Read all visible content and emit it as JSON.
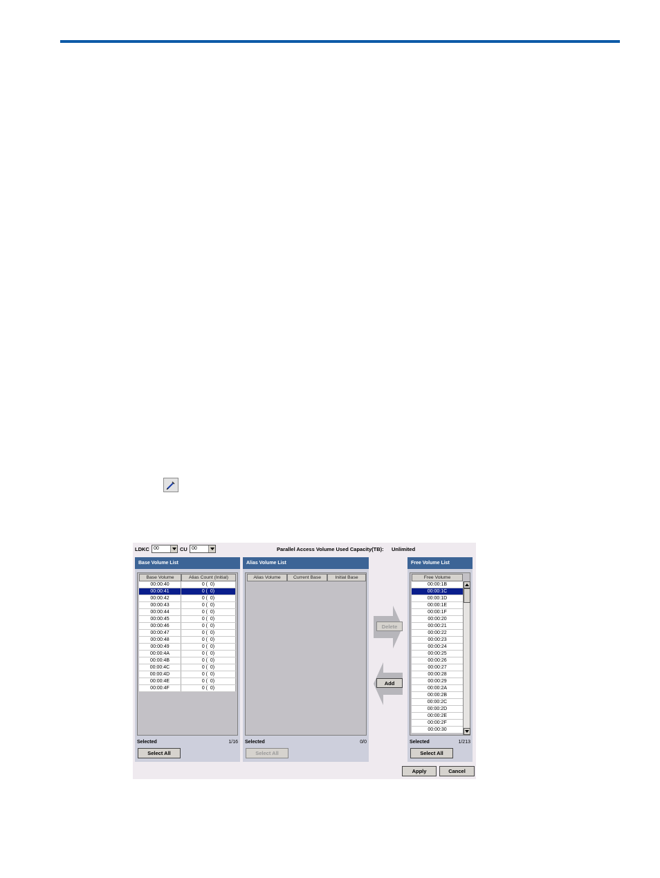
{
  "dialog": {
    "ldkc_label": "LDKC",
    "ldkc_value": "00",
    "cu_label": "CU",
    "cu_value": "00",
    "capacity_label": "Parallel Access Volume Used Capacity(TB):",
    "capacity_value": "Unlimited"
  },
  "base_panel": {
    "title": "Base Volume List",
    "columns": [
      "Base Volume",
      "Alias Count (Initial)"
    ],
    "rows": [
      [
        "00:00:40",
        "0 (  0)"
      ],
      [
        "00:00:41",
        "0 (  0)"
      ],
      [
        "00:00:42",
        "0 (  0)"
      ],
      [
        "00:00:43",
        "0 (  0)"
      ],
      [
        "00:00:44",
        "0 (  0)"
      ],
      [
        "00:00:45",
        "0 (  0)"
      ],
      [
        "00:00:46",
        "0 (  0)"
      ],
      [
        "00:00:47",
        "0 (  0)"
      ],
      [
        "00:00:48",
        "0 (  0)"
      ],
      [
        "00:00:49",
        "0 (  0)"
      ],
      [
        "00:00:4A",
        "0 (  0)"
      ],
      [
        "00:00:4B",
        "0 (  0)"
      ],
      [
        "00:00:4C",
        "0 (  0)"
      ],
      [
        "00:00:4D",
        "0 (  0)"
      ],
      [
        "00:00:4E",
        "0 (  0)"
      ],
      [
        "00:00:4F",
        "0 (  0)"
      ]
    ],
    "selected_row": 1,
    "selected_label": "Selected",
    "count": "1/16",
    "select_all": "Select All"
  },
  "alias_panel": {
    "title": "Alias Volume List",
    "columns": [
      "Alias Volume",
      "Current Base",
      "Initial Base"
    ],
    "selected_label": "Selected",
    "count": "0/0",
    "select_all": "Select All"
  },
  "arrows": {
    "delete_label": "Delete",
    "add_label": "Add"
  },
  "free_panel": {
    "title": "Free Volume List",
    "column": "Free Volume",
    "rows": [
      "00:00:1B",
      "00:00:1C",
      "00:00:1D",
      "00:00:1E",
      "00:00:1F",
      "00:00:20",
      "00:00:21",
      "00:00:22",
      "00:00:23",
      "00:00:24",
      "00:00:25",
      "00:00:26",
      "00:00:27",
      "00:00:28",
      "00:00:29",
      "00:00:2A",
      "00:00:2B",
      "00:00:2C",
      "00:00:2D",
      "00:00:2E",
      "00:00:2F",
      "00:00:30"
    ],
    "selected_row": 1,
    "selected_label": "Selected",
    "count": "1/213",
    "select_all": "Select All"
  },
  "footer": {
    "apply": "Apply",
    "cancel": "Cancel"
  }
}
